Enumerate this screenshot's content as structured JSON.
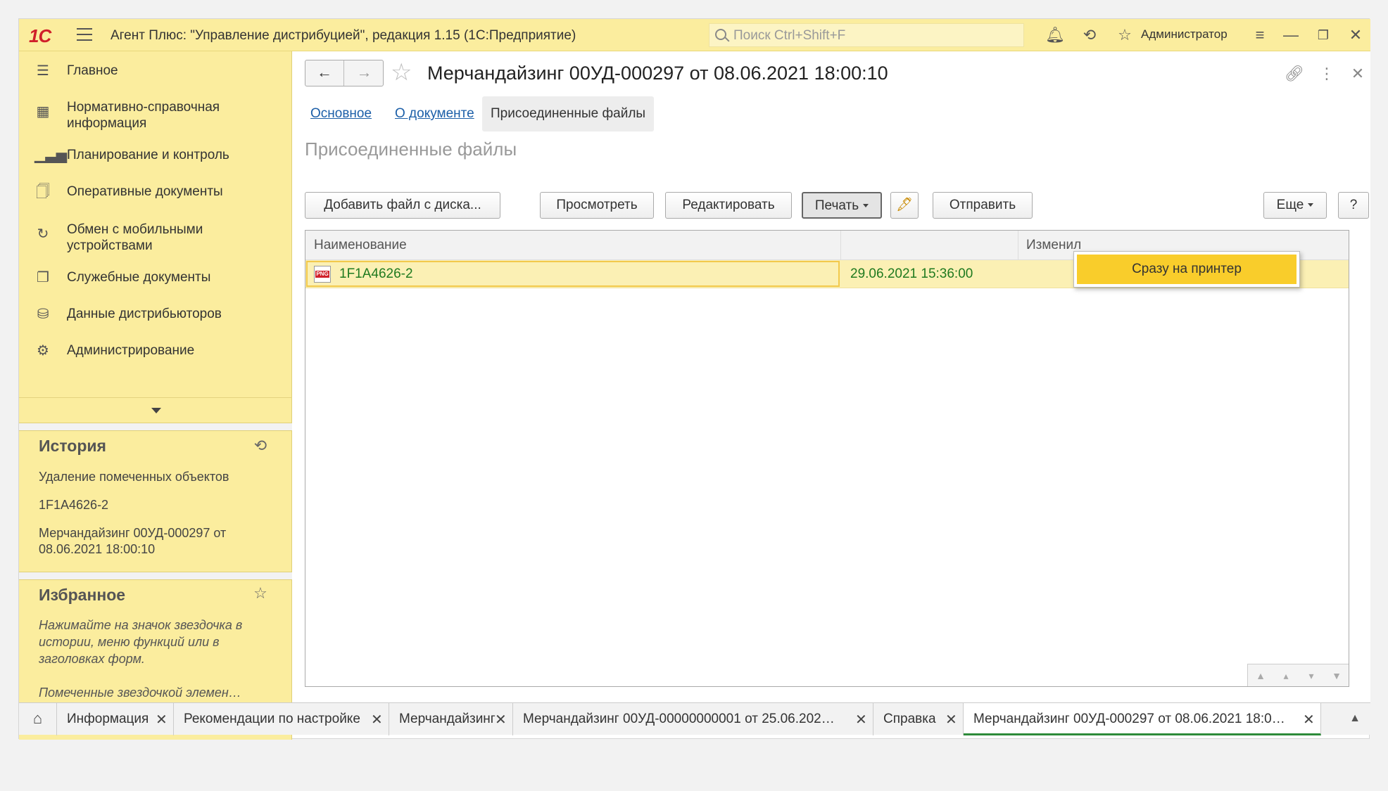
{
  "app": {
    "logo": "1С",
    "title": "Агент Плюс: \"Управление дистрибуцией\", редакция 1.15  (1С:Предприятие)",
    "search_placeholder": "Поиск Ctrl+Shift+F",
    "user": "Администратор"
  },
  "sidebar": {
    "items": [
      {
        "label": "Главное",
        "icon": "menu-lines-icon"
      },
      {
        "label": "Нормативно-справочная информация",
        "icon": "grid-icon"
      },
      {
        "label": "Планирование и контроль",
        "icon": "bar-chart-icon"
      },
      {
        "label": "Оперативные документы",
        "icon": "documents-icon"
      },
      {
        "label": "Обмен с мобильными устройствами",
        "icon": "sync-icon"
      },
      {
        "label": "Служебные документы",
        "icon": "service-docs-icon"
      },
      {
        "label": "Данные дистрибьюторов",
        "icon": "distributor-icon"
      },
      {
        "label": "Администрирование",
        "icon": "gear-icon"
      }
    ],
    "history": {
      "title": "История",
      "items": [
        "Удаление помеченных объектов",
        "1F1A4626-2",
        "Мерчандайзинг 00УД-000297 от 08.06.2021 18:00:10"
      ]
    },
    "favorites": {
      "title": "Избранное",
      "hint1": "Нажимайте на значок звездочка в истории, меню функций или в заголовках форм.",
      "hint2": "Помеченные звездочкой элемен…"
    }
  },
  "document": {
    "title": "Мерчандайзинг 00УД-000297 от 08.06.2021 18:00:10",
    "tabs": [
      {
        "label": "Основное",
        "active": false
      },
      {
        "label": "О документе",
        "active": false
      },
      {
        "label": "Присоединенные файлы",
        "active": true
      }
    ],
    "section_title": "Присоединенные файлы"
  },
  "toolbar": {
    "add_file": "Добавить файл с диска...",
    "view": "Просмотреть",
    "edit": "Редактировать",
    "print": "Печать",
    "send": "Отправить",
    "more": "Еще",
    "help": "?"
  },
  "print_menu": {
    "items": [
      "Сразу на принтер"
    ]
  },
  "files_table": {
    "columns": [
      "Наименование",
      "",
      "Изменил"
    ],
    "rows": [
      {
        "name": "1F1A4626-2",
        "type_badge": "PNG",
        "date": "29.06.2021 15:36:00",
        "changed_by": ""
      }
    ]
  },
  "taskbar": {
    "tabs": [
      {
        "label": "Информация"
      },
      {
        "label": "Рекомендации по настройке"
      },
      {
        "label": "Мерчандайзинг"
      },
      {
        "label": "Мерчандайзинг 00УД-00000000001 от 25.06.202…"
      },
      {
        "label": "Справка"
      },
      {
        "label": "Мерчандайзинг 00УД-000297 от 08.06.2021 18:0…"
      }
    ]
  },
  "colors": {
    "accent_yellow": "#fbed9e",
    "selection_yellow": "#f9cd2b",
    "link_blue": "#1c5fa8",
    "date_green": "#1f7a1f",
    "active_tab_underline": "#2e8b3a"
  }
}
